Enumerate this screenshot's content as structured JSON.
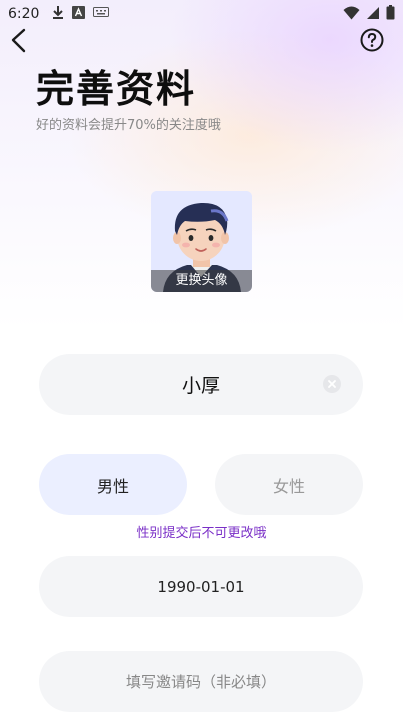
{
  "status_bar": {
    "time": "6:20",
    "left_icons": [
      "download-icon",
      "a-icon",
      "keyboard-icon"
    ],
    "right_icons": [
      "wifi-icon",
      "signal-icon",
      "battery-icon"
    ]
  },
  "header": {
    "title": "完善资料",
    "subtitle": "好的资料会提升70%的关注度哦"
  },
  "avatar": {
    "change_label": "更换头像"
  },
  "form": {
    "nickname_value": "小厚",
    "gender": {
      "male_label": "男性",
      "female_label": "女性",
      "selected": "男性",
      "note": "性别提交后不可更改哦"
    },
    "birthday_value": "1990-01-01",
    "invite_placeholder": "填写邀请码（非必填）"
  },
  "colors": {
    "accent_purple": "#7a2fc7",
    "selected_bg": "#ebefff",
    "field_bg": "#f4f5f7"
  }
}
